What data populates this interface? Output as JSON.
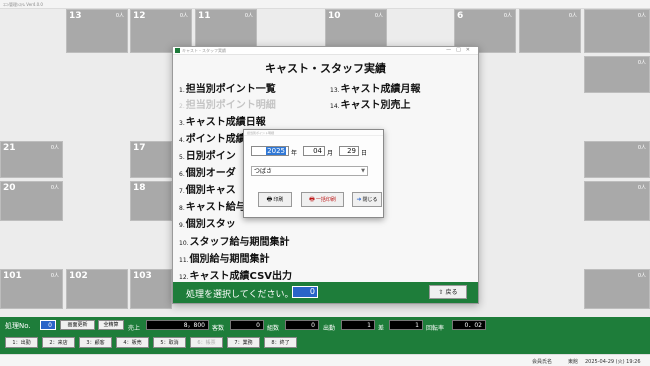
{
  "window_title": "ｺﾆｼ管理ｼｽﾃﾑ Ver4.0.0",
  "tables_top": [
    {
      "num": "",
      "count": ""
    },
    {
      "num": "13",
      "count": "0人"
    },
    {
      "num": "12",
      "count": "0人"
    },
    {
      "num": "11",
      "count": "0人"
    },
    {
      "num": "10",
      "count": "0人"
    },
    {
      "num": "6",
      "count": "0人"
    },
    {
      "num": "",
      "count": "0人"
    },
    {
      "num": "",
      "count": "0人"
    }
  ],
  "tables_left": [
    {
      "num": "21",
      "count": "0人"
    },
    {
      "num": "20",
      "count": "0人"
    },
    {
      "num": "101",
      "count": "0人"
    }
  ],
  "tables_center": [
    {
      "num": "17",
      "count": ""
    },
    {
      "num": "18",
      "count": ""
    },
    {
      "num": "102",
      "count": ""
    },
    {
      "num": "103",
      "count": ""
    }
  ],
  "tables_right": [
    {
      "num": "",
      "count": "0人"
    },
    {
      "num": "",
      "count": "0人"
    },
    {
      "num": "",
      "count": "0人"
    },
    {
      "num": "",
      "count": "0人"
    },
    {
      "num": "",
      "count": "0人"
    }
  ],
  "dialog": {
    "title": "キャスト・スタッフ実績",
    "title_bar": "キャスト・スタッフ実績",
    "items_left": [
      {
        "n": "1.",
        "t": "担当別ポイント一覧",
        "disabled": false
      },
      {
        "n": "2.",
        "t": "担当別ポイント明細",
        "disabled": true
      },
      {
        "n": "3.",
        "t": "キャスト成績日報",
        "disabled": false
      },
      {
        "n": "4.",
        "t": "ポイント成績",
        "disabled": false
      },
      {
        "n": "5.",
        "t": "日別ポイン",
        "disabled": false
      },
      {
        "n": "6.",
        "t": "個別オーダ",
        "disabled": false
      },
      {
        "n": "7.",
        "t": "個別キャス",
        "disabled": false
      },
      {
        "n": "8.",
        "t": "キャスト給与",
        "disabled": false
      },
      {
        "n": "9.",
        "t": "個別スタッ",
        "disabled": false
      },
      {
        "n": "10.",
        "t": "スタッフ給与期間集計",
        "disabled": false
      },
      {
        "n": "11.",
        "t": "個別給与期間集計",
        "disabled": false
      },
      {
        "n": "12.",
        "t": "キャスト成績CSV出力",
        "disabled": false
      }
    ],
    "items_right": [
      {
        "n": "13.",
        "t": "キャスト成績月報",
        "disabled": false
      },
      {
        "n": "14.",
        "t": "キャスト別売上",
        "disabled": false
      }
    ],
    "footer_label": "処理を選択してください。",
    "footer_value": "0",
    "back_label": "戻る"
  },
  "sub_dialog": {
    "title": "担当別ポイント明細",
    "year": "2025",
    "year_unit": "年",
    "month": "04",
    "month_unit": "月",
    "day": "29",
    "day_unit": "日",
    "selected": "つばさ",
    "print_label": "印刷",
    "batch_print_label": "一括印刷",
    "close_label": "閉じる"
  },
  "toolbar": {
    "proc_label": "処理No.",
    "proc_value": "0",
    "refresh_label": "画面更新",
    "settle_label": "全精算",
    "sales_label": "売上",
    "sales_value": "8，800",
    "customers_label": "客数",
    "customers_value": "0",
    "groups_label": "組数",
    "groups_value": "0",
    "attendance_label": "出勤",
    "attendance_value": "1",
    "diff_label": "差",
    "diff_value": "1",
    "turnover_label": "回転率",
    "turnover_value": "0．02"
  },
  "fkeys": [
    {
      "label": "1：出勤",
      "disabled": false
    },
    {
      "label": "2：来店",
      "disabled": false
    },
    {
      "label": "3：顧客",
      "disabled": false
    },
    {
      "label": "4：販売",
      "disabled": false
    },
    {
      "label": "5：取消",
      "disabled": false
    },
    {
      "label": "6：帳票",
      "disabled": true
    },
    {
      "label": "7：業務",
      "disabled": false
    },
    {
      "label": "8：終了",
      "disabled": false
    }
  ],
  "status": {
    "member_label": "会員氏名",
    "shop": "東館",
    "datetime": "2025-04-29 (火) 19:26"
  }
}
